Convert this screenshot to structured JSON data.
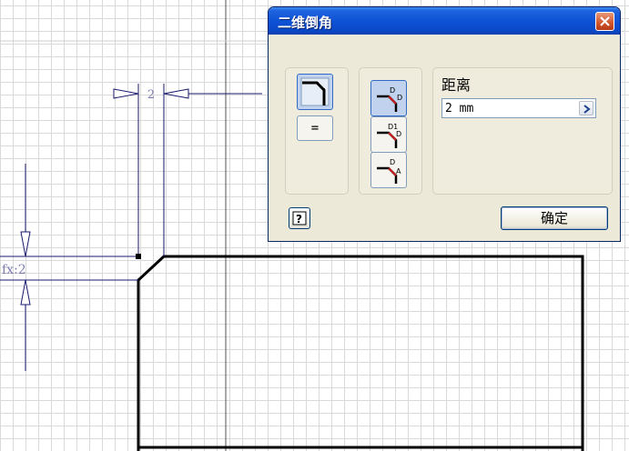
{
  "dialog": {
    "title": "二维倒角",
    "close_icon": "close-icon",
    "mode_buttons": [
      {
        "name": "chamfer-preview-icon",
        "active": true
      },
      {
        "name": "equal-constraint",
        "label": "="
      }
    ],
    "method_buttons": [
      {
        "name": "distance-method-icon",
        "active": true
      },
      {
        "name": "distance-distance-method-icon",
        "active": false
      },
      {
        "name": "distance-angle-method-icon",
        "active": false
      }
    ],
    "distance_label": "距离",
    "distance_value": "2 mm",
    "distance_arrow_icon": "chevron-right-icon",
    "help_icon": "help-icon",
    "ok_label": "确定"
  },
  "sketch": {
    "dim_horizontal": "2",
    "dim_vertical": "fx:2"
  }
}
